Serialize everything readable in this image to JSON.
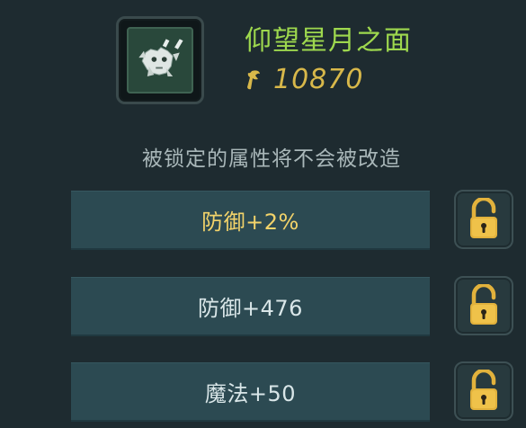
{
  "item": {
    "name": "仰望星月之面",
    "icon": "mask-icon",
    "price": "10870",
    "price_icon": "currency-icon"
  },
  "notice": "被锁定的属性将不会被改造",
  "attributes": [
    {
      "label": "防御+2%",
      "highlight": true,
      "lock_state": "unlocked"
    },
    {
      "label": "防御+476",
      "highlight": false,
      "lock_state": "unlocked"
    },
    {
      "label": "魔法+50",
      "highlight": false,
      "lock_state": "unlocked"
    }
  ],
  "colors": {
    "background": "#1e2b30",
    "item_name": "#9ed84e",
    "price": "#d8b84a",
    "highlight_attribute": "#f2d36a",
    "lock_gold": "#e2b23c"
  }
}
